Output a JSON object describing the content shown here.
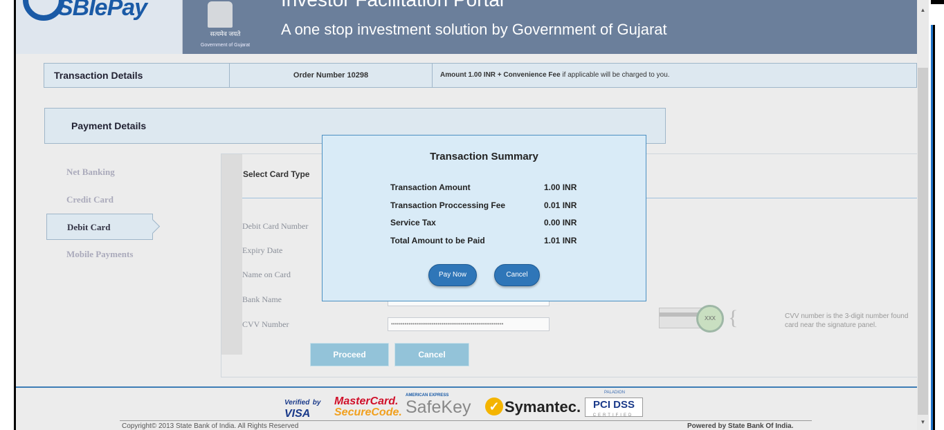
{
  "header": {
    "logo_text": "SBIePay",
    "emblem_hindi": "सत्यमेव जयते",
    "emblem_caption": "Government of Gujarat",
    "portal_title": "Investor Facilitation Portal",
    "portal_subtitle": "A one stop investment solution by Government of Gujarat"
  },
  "transaction_bar": {
    "title": "Transaction Details",
    "order": "Order Number 10298",
    "amount_prefix": "Amount 1.00 INR + Convenience Fee",
    "amount_suffix": " if applicable will be charged to you."
  },
  "payment": {
    "title": "Payment Details",
    "methods": [
      "Net Banking",
      "Credit Card",
      "Debit Card",
      "Mobile Payments"
    ],
    "active_method": "Debit Card"
  },
  "form": {
    "select_card_label": "Select Card Type",
    "debit_card_number_label": "Debit Card Number",
    "expiry_label": "Expiry Date",
    "name_label": "Name on Card",
    "bank_label": "Bank Name",
    "bank_value": "",
    "cvv_label": "CVV Number",
    "cvv_value": "••••••••••••••••••••••••••••••••••••••••••••••••••••••••••",
    "cvv_sample": "XXX",
    "cvv_help": "CVV number is the 3-digit number found card near the signature panel.",
    "proceed_label": "Proceed",
    "cancel_label": "Cancel"
  },
  "modal": {
    "title": "Transaction Summary",
    "rows": [
      {
        "label": "Transaction Amount",
        "value": "1.00 INR"
      },
      {
        "label": "Transaction Proccessing Fee",
        "value": "0.01 INR"
      },
      {
        "label": "Service Tax",
        "value": "0.00 INR"
      },
      {
        "label": "Total Amount to be Paid",
        "value": "1.01 INR"
      }
    ],
    "pay_now_label": "Pay Now",
    "cancel_label": "Cancel"
  },
  "footer": {
    "verified": "Verified",
    "verified_by": "by",
    "visa": "VISA",
    "mastercard": "MasterCard.",
    "securecode": "SecureCode.",
    "amex": "AMERICAN EXPRESS",
    "safekey": "SafeKey",
    "symantec": "Symantec.",
    "paladion": "PALADION",
    "pcidss": "PCI DSS",
    "certified": "CERTIFIED",
    "copyright": "Copyright© 2013 State Bank of India. All Rights Reserved",
    "powered": "Powered by State Bank Of India."
  }
}
